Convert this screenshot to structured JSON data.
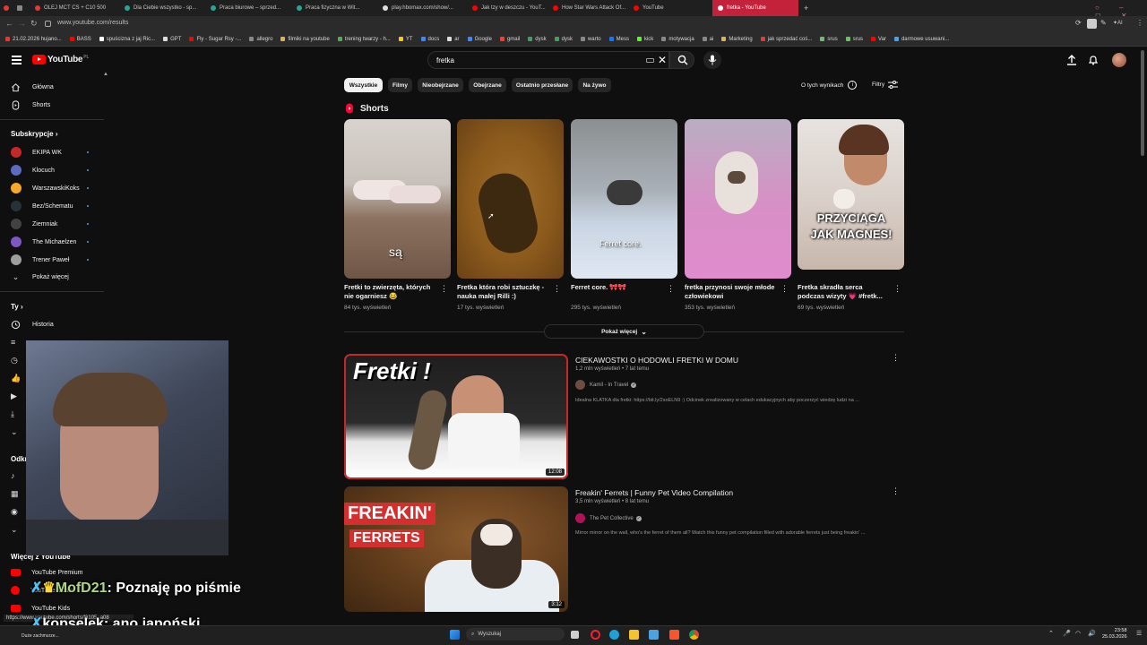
{
  "browser": {
    "tabs": [
      "OLEJ MCT CS + C10 500",
      "Dla Ciebie wszystko - sp...",
      "Praca biurowe – sprzed...",
      "Praca fizyczna w Wit...",
      "play.hbomax.com/show/...",
      "Jak tzy w deszczu - YouT...",
      "How Star Wars Attack Of...",
      "YouTube",
      "fretka - YouTube"
    ],
    "url": "www.youtube.com/results",
    "bookmarks": [
      "21.02.2026 hujano...",
      "BASS",
      "spuścizna z jaj Ric...",
      "GPT",
      "Fly - Sugar Rsy -...",
      "allegro",
      "filmiki na youtube",
      "trening twarzy - h...",
      "YT",
      "docs",
      "ar",
      "Google",
      "gmail",
      "dysk",
      "dysk",
      "warto",
      "Mess",
      "kick",
      "motywacja",
      "ai",
      "Marketing",
      "jak sprzedać coś...",
      "srus",
      "srus",
      "Var",
      "darmowe usuwani..."
    ]
  },
  "masthead": {
    "logo": "YouTube",
    "region": "PL",
    "search_value": "fretka"
  },
  "sidebar": {
    "main": [
      {
        "label": "Główna",
        "icon": "home-icon"
      },
      {
        "label": "Shorts",
        "icon": "shorts-icon"
      }
    ],
    "subs_header": "Subskrypcje",
    "subscriptions": [
      {
        "label": "EKIPA WK",
        "color": "#c62828"
      },
      {
        "label": "Klocuch",
        "color": "#5c6bc0"
      },
      {
        "label": "WarszawskiKoks",
        "color": "#f9a825"
      },
      {
        "label": "Bez/Schematu",
        "color": "#263238"
      },
      {
        "label": "Ziemniak",
        "color": "#424242"
      },
      {
        "label": "The Michaelzen",
        "color": "#7e57c2"
      },
      {
        "label": "Trener Paweł",
        "color": "#9e9e9e"
      }
    ],
    "show_more": "Pokaż więcej",
    "you_header": "Ty",
    "history": "Historia",
    "explore_header": "Odkr",
    "more_header": "Więcej z YouTube",
    "more": [
      "YouTube Premium",
      "YouTube Music",
      "YouTube Kids"
    ]
  },
  "filters": {
    "chips": [
      "Wszystkie",
      "Filmy",
      "Nieobejrzane",
      "Obejrzane",
      "Ostatnio przesłane",
      "Na żywo"
    ],
    "about": "O tych wynikach",
    "filters_label": "Filtry"
  },
  "shorts": {
    "heading": "Shorts",
    "items": [
      {
        "title": "Fretki to zwierzęta, których nie ogarniesz 😂",
        "views": "84 tys. wyświetleń",
        "overlay": "są"
      },
      {
        "title": "Fretka która robi sztuczkę - nauka małej Rilli :)",
        "views": "17 tys. wyświetleń",
        "overlay": ""
      },
      {
        "title": "Ferret core. 🎀🎀",
        "views": "295 tys. wyświetleń",
        "overlay": "Ferret core."
      },
      {
        "title": "fretka przynosi swoje młode człowiekowi",
        "views": "353 tys. wyświetleń",
        "overlay": ""
      },
      {
        "title": "Fretka skradła serca podczas wizyty 💗 #fretk...",
        "views": "69 tys. wyświetleń",
        "overlay": "PRZYCIĄGA JAK MAGNES!"
      }
    ],
    "show_more": "Pokaż więcej"
  },
  "videos": [
    {
      "title": "CIEKAWOSTKI O HODOWLI FRETKI W DOMU",
      "meta": "1,2 mln wyświetleń • 7 lat temu",
      "channel": "Kamil - In Travel",
      "desc": "Idealna KLATKA dla fretki: https://bit.ly/2soELN9 :) Odcinek zrealizowany w celach edukacyjnych aby poczerzyć wiedzę ludzi na ...",
      "duration": "12:08",
      "thumb_text": "Fretki !"
    },
    {
      "title": "Freakin' Ferrets | Funny Pet Video Compilation",
      "meta": "3,5 mln wyświetleń • 8 lat temu",
      "channel": "The Pet Collective",
      "desc": "Mirror mirror on the wall, who's the ferret of them all? Watch this funny pet compilation filled with adorable ferrets just being freakin' ...",
      "duration": "3:12",
      "thumb_text_1": "FREAKIN'",
      "thumb_text_2": "FERRETS"
    }
  ],
  "stream": {
    "chat": [
      {
        "user": "MofD21",
        "message": "Poznaję po piśmie"
      },
      {
        "user": "kopselek",
        "message": "ano japoński"
      }
    ],
    "status_url": "https://www.youtube.com/shorts/f6105_a08"
  },
  "taskbar": {
    "weather": "Duże zachmurze...",
    "search": "Wyszukaj",
    "time": "23:58",
    "date": "25.03.2026"
  }
}
